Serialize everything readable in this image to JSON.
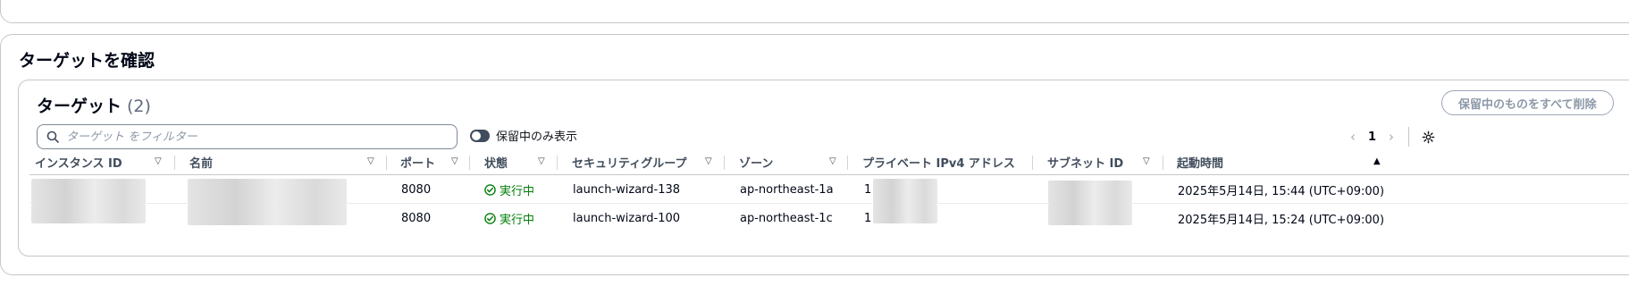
{
  "review": {
    "title": "ターゲットを確認"
  },
  "targets": {
    "title": "ターゲット",
    "count": "(2)",
    "remove_all_label": "保留中のものをすべて削除",
    "filter_placeholder": "ターゲット をフィルター",
    "toggle_label": "保留中のみ表示",
    "page": "1"
  },
  "table": {
    "columns": [
      "インスタンス ID",
      "名前",
      "ポート",
      "状態",
      "セキュリティグループ",
      "ゾーン",
      "プライベート IPv4 アドレス",
      "サブネット ID",
      "起動時間"
    ],
    "rows": [
      {
        "instance_id": "",
        "name": "",
        "port": "8080",
        "status": "実行中",
        "security_group": "launch-wizard-138",
        "zone": "ap-northeast-1a",
        "ip": "1",
        "subnet": "",
        "launch_time": "2025年5月14日, 15:44 (UTC+09:00)"
      },
      {
        "instance_id": "",
        "name": "",
        "port": "8080",
        "status": "実行中",
        "security_group": "launch-wizard-100",
        "zone": "ap-northeast-1c",
        "ip": "1",
        "subnet": "",
        "launch_time": "2025年5月14日, 15:24 (UTC+09:00)"
      }
    ]
  },
  "colors": {
    "status_running": "#037f0c",
    "border": "#c6c6cd",
    "muted": "#8d99a8"
  },
  "icons": [
    "search-icon",
    "toggle-switch",
    "chevron-left-icon",
    "chevron-right-icon",
    "gear-icon",
    "sort-icon",
    "status-check-icon"
  ]
}
